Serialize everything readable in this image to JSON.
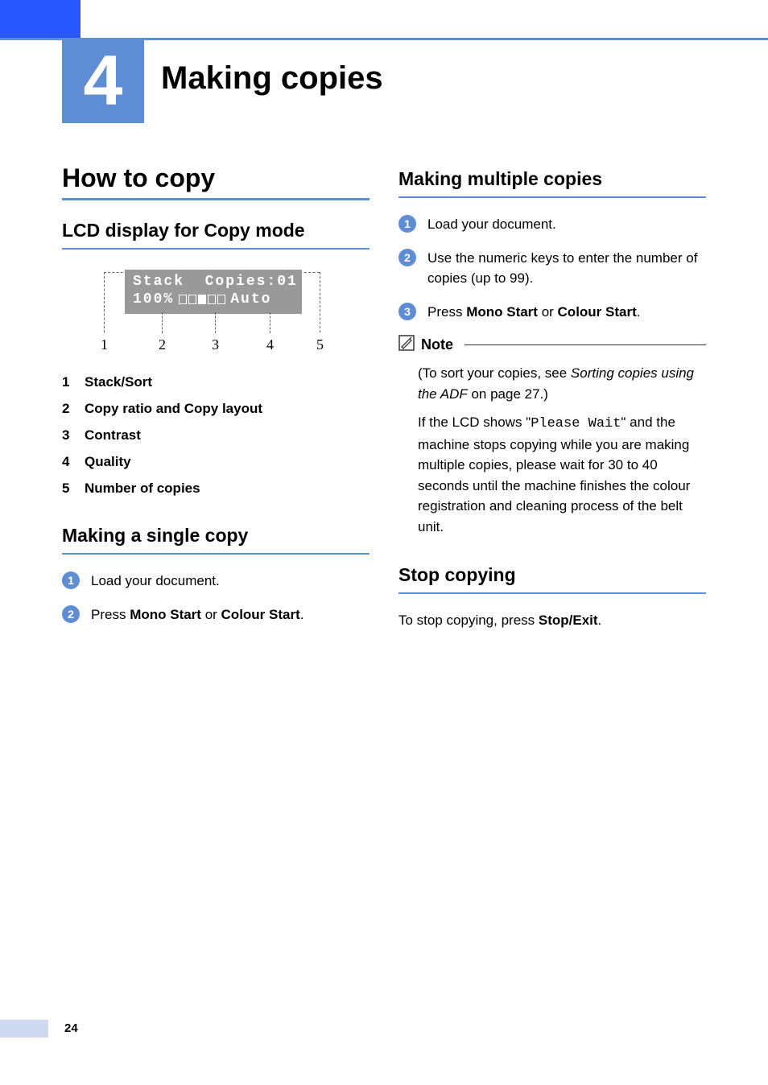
{
  "chapter": {
    "number": "4",
    "title": "Making copies"
  },
  "left": {
    "h2": "How to copy",
    "section_lcd": {
      "title": "LCD display for Copy mode",
      "lcd": {
        "line1_left": "Stack",
        "line1_right": "Copies:01",
        "line2_left": "100%",
        "line2_right": "Auto"
      },
      "legend": [
        {
          "num": "1",
          "label": "Stack/Sort"
        },
        {
          "num": "2",
          "label": "Copy ratio and Copy layout"
        },
        {
          "num": "3",
          "label": "Contrast"
        },
        {
          "num": "4",
          "label": "Quality"
        },
        {
          "num": "5",
          "label": "Number of copies"
        }
      ]
    },
    "section_single": {
      "title": "Making a single copy",
      "steps": {
        "s1": "Load your document.",
        "s2_pre": "Press ",
        "s2_btn1": "Mono Start",
        "s2_mid": " or ",
        "s2_btn2": "Colour Start",
        "s2_post": "."
      }
    }
  },
  "right": {
    "section_multiple": {
      "title": "Making multiple copies",
      "steps": {
        "s1": "Load your document.",
        "s2": "Use the numeric keys to enter the number of copies (up to 99).",
        "s3_pre": "Press ",
        "s3_btn1": "Mono Start",
        "s3_mid": " or ",
        "s3_btn2": "Colour Start",
        "s3_post": "."
      },
      "note": {
        "label": "Note",
        "p1_pre": "(To sort your copies, see ",
        "p1_link": "Sorting copies using the ADF",
        "p1_post": " on page 27.)",
        "p2_pre": "If the LCD shows \"",
        "p2_lcd": "Please Wait",
        "p2_post": "\" and the machine stops copying while you are making multiple copies, please wait for 30 to 40 seconds until the machine finishes the colour registration and cleaning process of the belt unit."
      }
    },
    "section_stop": {
      "title": "Stop copying",
      "text_pre": "To stop copying, press ",
      "text_btn": "Stop/Exit",
      "text_post": "."
    }
  },
  "page_number": "24"
}
